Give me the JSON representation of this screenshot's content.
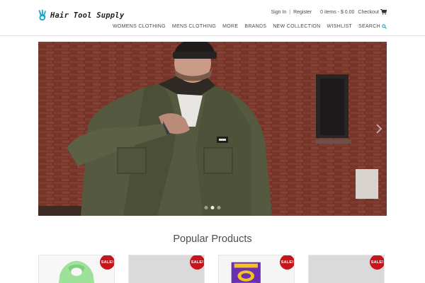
{
  "brand": {
    "logo_icon": "hand-peace-icon",
    "name": "Hair Tool Supply",
    "accent_color": "#1ba7c9"
  },
  "account": {
    "sign_in": "Sign In",
    "separator": "|",
    "register": "Register",
    "cart_summary": "0 items - $ 0.00",
    "checkout": "Checkout",
    "cart_icon": "shopping-cart-icon"
  },
  "nav": {
    "items": [
      {
        "label": "WOMENS CLOTHING"
      },
      {
        "label": "MENS CLOTHING"
      },
      {
        "label": "MORE"
      },
      {
        "label": "BRANDS"
      },
      {
        "label": "NEW COLLECTION"
      },
      {
        "label": "WISHLIST"
      }
    ],
    "search_label": "SEARCH",
    "search_icon": "search-icon"
  },
  "hero": {
    "image": "man-in-olive-jacket-brick-wall-photo",
    "slide_count": 3,
    "active_slide": 1
  },
  "popular": {
    "title": "Popular Products",
    "products": [
      {
        "image": "green-hoodie-photo",
        "badge": "SALE!"
      },
      {
        "image": "grey-product-photo",
        "badge": "SALE!"
      },
      {
        "image": "purple-graphic-tee-photo",
        "badge": "SALE!"
      },
      {
        "image": "grey-product-photo",
        "badge": "SALE!"
      }
    ]
  },
  "colors": {
    "sale_badge": "#c4161c",
    "nav_text": "#4a4a4a",
    "search_icon": "#1ba7c9"
  }
}
